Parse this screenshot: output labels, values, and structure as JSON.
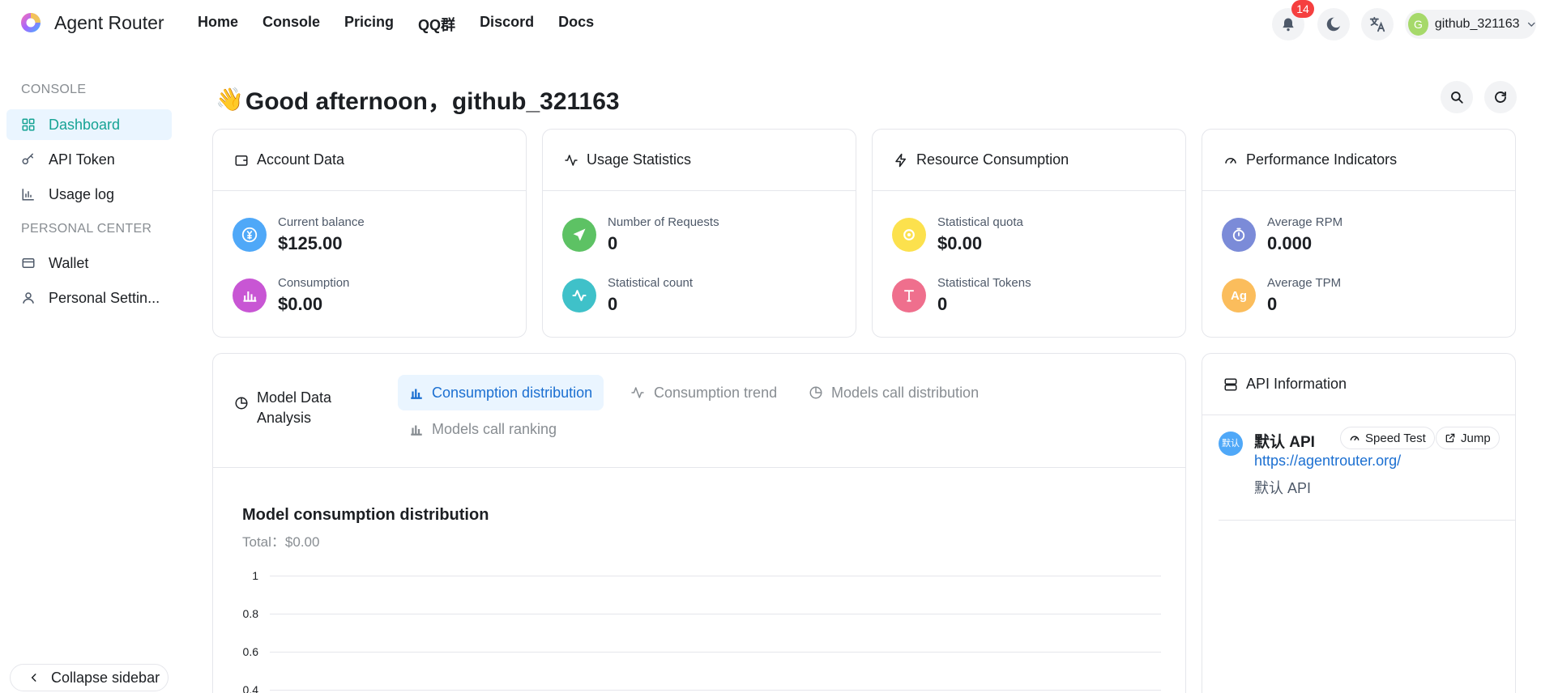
{
  "brand": {
    "name": "Agent Router"
  },
  "nav": [
    "Home",
    "Console",
    "Pricing",
    "QQ群",
    "Discord",
    "Docs"
  ],
  "topbar": {
    "notification_count": "14",
    "user_initial": "G",
    "username": "github_321163"
  },
  "sidebar": {
    "sections": [
      {
        "title": "CONSOLE",
        "items": [
          {
            "label": "Dashboard",
            "icon": "dashboard-icon",
            "active": true
          },
          {
            "label": "API Token",
            "icon": "key-icon"
          },
          {
            "label": "Usage log",
            "icon": "bar-chart-icon"
          }
        ]
      },
      {
        "title": "PERSONAL CENTER",
        "items": [
          {
            "label": "Wallet",
            "icon": "wallet-icon"
          },
          {
            "label": "Personal Settin...",
            "icon": "user-icon"
          }
        ]
      }
    ],
    "collapse_label": "Collapse sidebar"
  },
  "greeting": {
    "emoji": "👋",
    "text": "Good afternoon，github_321163"
  },
  "cards": [
    {
      "title": "Account Data",
      "icon": "wallet-icon",
      "stats": [
        {
          "label": "Current balance",
          "value": "$125.00",
          "icon": "yen-coin-icon",
          "color": "#4fa8f8"
        },
        {
          "label": "Consumption",
          "value": "$0.00",
          "icon": "bar-chart-icon",
          "color": "#c856d4"
        }
      ]
    },
    {
      "title": "Usage Statistics",
      "icon": "pulse-icon",
      "stats": [
        {
          "label": "Number of Requests",
          "value": "0",
          "icon": "send-icon",
          "color": "#5dc264"
        },
        {
          "label": "Statistical count",
          "value": "0",
          "icon": "pulse-icon",
          "color": "#3fc1c9"
        }
      ]
    },
    {
      "title": "Resource Consumption",
      "icon": "lightning-icon",
      "stats": [
        {
          "label": "Statistical quota",
          "value": "$0.00",
          "icon": "coin-icon",
          "color": "#fce14d"
        },
        {
          "label": "Statistical Tokens",
          "value": "0",
          "icon": "text-icon",
          "color": "#ef6f8d"
        }
      ]
    },
    {
      "title": "Performance Indicators",
      "icon": "gauge-icon",
      "stats": [
        {
          "label": "Average RPM",
          "value": "0.000",
          "icon": "stopwatch-icon",
          "color": "#7b8bd8"
        },
        {
          "label": "Average TPM",
          "value": "0",
          "icon": "ag-text-icon",
          "color": "#fbbd5c"
        }
      ]
    }
  ],
  "analysis": {
    "title_line1": "Model Data",
    "title_line2": "Analysis",
    "tabs": [
      {
        "label": "Consumption distribution",
        "active": true
      },
      {
        "label": "Consumption trend"
      },
      {
        "label": "Models call distribution"
      },
      {
        "label": "Models call ranking"
      }
    ],
    "chart_title": "Model consumption distribution",
    "chart_total": "Total：$0.00"
  },
  "chart_data": {
    "type": "bar",
    "title": "Model consumption distribution",
    "subtitle": "Total：$0.00",
    "categories": [],
    "values": [],
    "y_ticks": [
      "1",
      "0.8",
      "0.6",
      "0.4"
    ],
    "ylim": [
      0,
      1
    ],
    "grid": true
  },
  "api_info": {
    "title": "API Information",
    "entry": {
      "avatar_text": "默认",
      "name": "默认 API",
      "speed_test_label": "Speed Test",
      "jump_label": "Jump",
      "url": "https://agentrouter.org/",
      "description": "默认 API"
    }
  }
}
